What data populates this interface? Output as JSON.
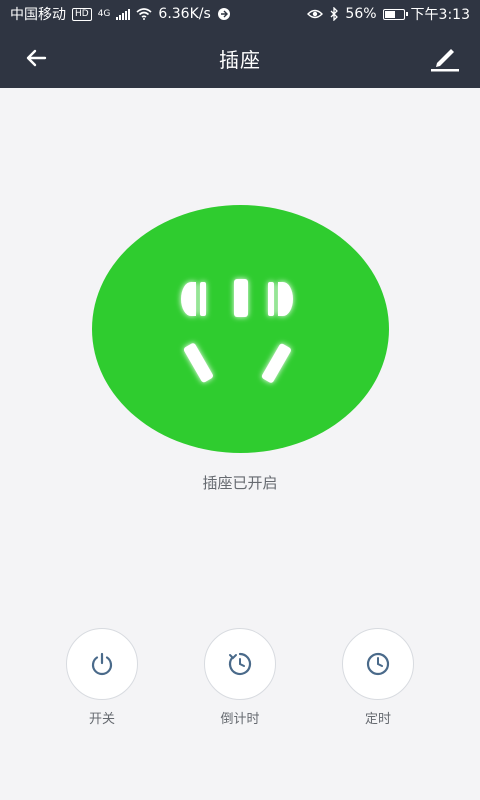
{
  "status_bar": {
    "carrier": "中国移动",
    "hd": "HD",
    "network": "4G",
    "speed": "6.36K/s",
    "battery": "56%",
    "battery_level": 0.56,
    "time": "下午3:13"
  },
  "header": {
    "title": "插座"
  },
  "socket": {
    "status_text": "插座已开启",
    "color": "#2fcc2f"
  },
  "actions": [
    {
      "label": "开关"
    },
    {
      "label": "倒计时"
    },
    {
      "label": "定时"
    }
  ]
}
